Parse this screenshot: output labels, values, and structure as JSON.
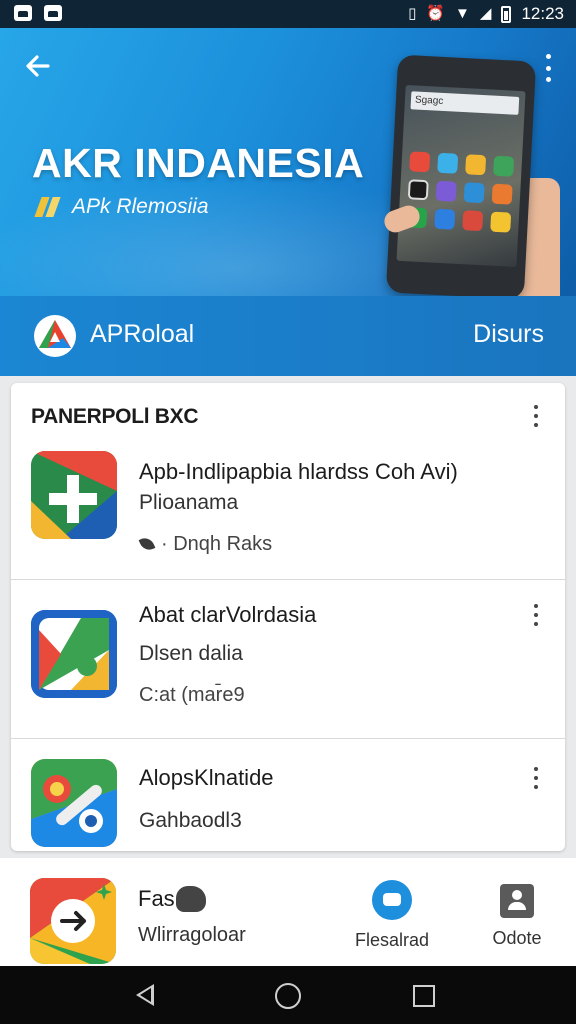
{
  "status_bar": {
    "time": "12:23",
    "icons": [
      "image-notification-icon",
      "cloud-notification-icon",
      "vibrate-icon",
      "alarm-icon",
      "wifi-icon",
      "signal-icon",
      "battery-icon"
    ]
  },
  "hero": {
    "title": "AKR INDANESIA",
    "subtitle": "APk Rlemosiia",
    "search_text": "Sgagc",
    "colors": {
      "gradient_start": "#27a6e8",
      "gradient_end": "#0e5da8"
    }
  },
  "publisher": {
    "name": "APRoloal",
    "action_label": "Disurs"
  },
  "list": {
    "header": "PANERPOLl BXC",
    "items": [
      {
        "title": "Apb-Indlipapbia hlardss Coh Avi)",
        "subtitle": "Plioanama",
        "meta": "· Dnqh Raks",
        "icon": "app-icon-plus"
      },
      {
        "title": "Abat clarVolrdasia",
        "subtitle": "Dlsen dalia",
        "meta": "C:at (mar̄e9",
        "icon": "app-icon-maps"
      },
      {
        "title": "AlopsKlnatide",
        "subtitle": "Gahbaodl3",
        "meta": "",
        "icon": "app-icon-brush"
      }
    ]
  },
  "bottom_panel": {
    "app_title": "Fas",
    "app_subtitle": "Wlirragoloar",
    "tabs": [
      {
        "label": "Flesalrad",
        "icon": "installed-icon"
      },
      {
        "label": "Odote",
        "icon": "update-icon"
      }
    ]
  },
  "nav": {
    "buttons": [
      "back-icon",
      "home-icon",
      "recents-icon"
    ]
  }
}
